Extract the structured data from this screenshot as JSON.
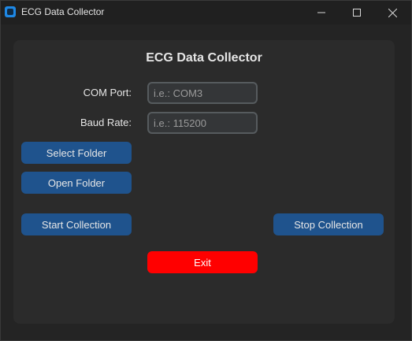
{
  "window": {
    "title": "ECG Data Collector",
    "icon": "app-icon",
    "controls": [
      "minimize-icon",
      "maximize-icon",
      "close-icon"
    ]
  },
  "main": {
    "heading": "ECG Data Collector",
    "com_port": {
      "label": "COM Port:",
      "placeholder": "i.e.: COM3",
      "value": ""
    },
    "baud_rate": {
      "label": "Baud Rate:",
      "placeholder": "i.e.: 115200",
      "value": ""
    },
    "buttons": {
      "select_folder": "Select Folder",
      "open_folder": "Open Folder",
      "start_collection": "Start Collection",
      "stop_collection": "Stop Collection",
      "exit": "Exit"
    }
  },
  "colors": {
    "accent": "#1f538d",
    "exit": "#ff0000",
    "panel": "#2b2b2b",
    "background": "#242424"
  }
}
